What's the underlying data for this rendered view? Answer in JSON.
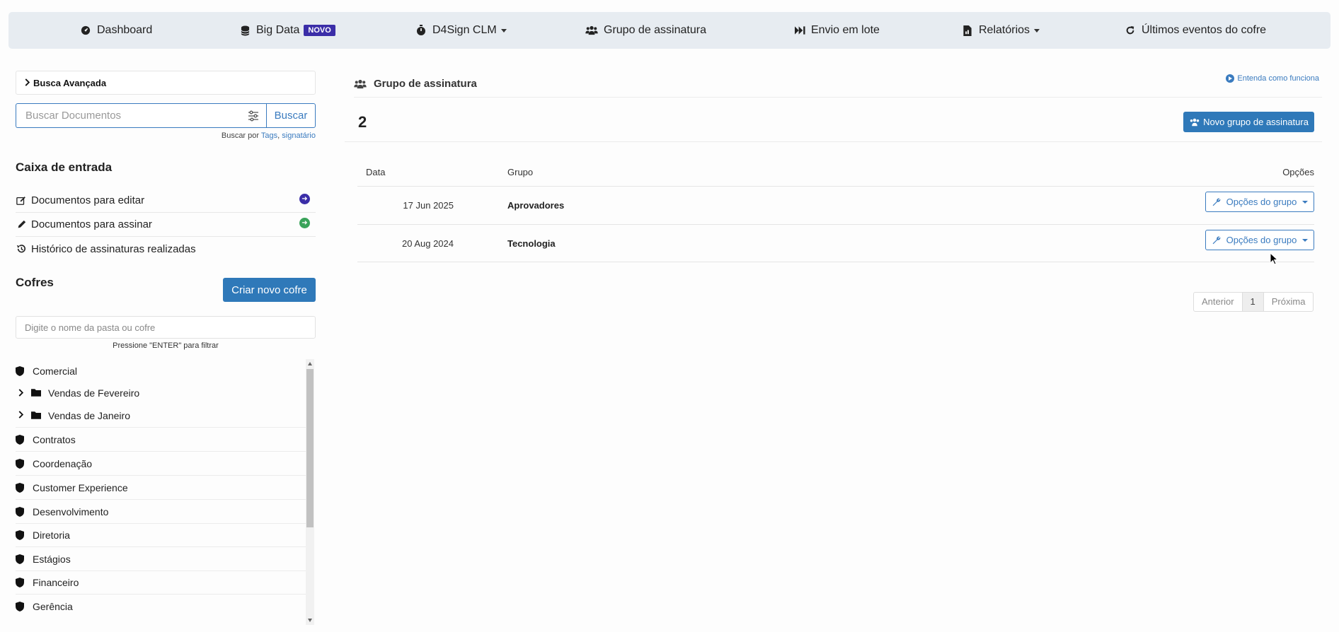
{
  "navbar": {
    "items": [
      {
        "label": "Dashboard",
        "icon": "dashboard-icon"
      },
      {
        "label": "Big Data",
        "icon": "database-icon",
        "badge": "NOVO"
      },
      {
        "label": "D4Sign CLM",
        "icon": "stopwatch-icon",
        "dropdown": true
      },
      {
        "label": "Grupo de assinatura",
        "icon": "users-icon"
      },
      {
        "label": "Envio em lote",
        "icon": "fast-forward-icon"
      },
      {
        "label": "Relatórios",
        "icon": "file-report-icon",
        "dropdown": true
      },
      {
        "label": "Últimos eventos do cofre",
        "icon": "refresh-icon"
      }
    ]
  },
  "sidebar": {
    "busca_avancada": "Busca Avançada",
    "search_placeholder": "Buscar Documentos",
    "search_button": "Buscar",
    "search_hint_prefix": "Buscar por ",
    "search_hint_tags": "Tags",
    "search_hint_sep": ", ",
    "search_hint_signatario": "signatário",
    "inbox_title": "Caixa de entrada",
    "inbox_items": [
      {
        "label": "Documentos para editar"
      },
      {
        "label": "Documentos para assinar"
      },
      {
        "label": "Histórico de assinaturas realizadas"
      }
    ],
    "cofres_title": "Cofres",
    "criar_cofre": "Criar novo cofre",
    "pasta_placeholder": "Digite o nome da pasta ou cofre",
    "pasta_hint": "Pressione \"ENTER\" para filtrar",
    "cofres": [
      {
        "label": "Comercial"
      },
      {
        "label": "Vendas de Fevereiro"
      },
      {
        "label": "Vendas de Janeiro"
      },
      {
        "label": "Contratos"
      },
      {
        "label": "Coordenação"
      },
      {
        "label": "Customer Experience"
      },
      {
        "label": "Desenvolvimento"
      },
      {
        "label": "Diretoria"
      },
      {
        "label": "Estágios"
      },
      {
        "label": "Financeiro"
      },
      {
        "label": "Gerência"
      }
    ]
  },
  "main": {
    "title": "Grupo de assinatura",
    "help_link": "Entenda como funciona",
    "count": "2",
    "new_button": "Novo grupo de assinatura",
    "table": {
      "headers": {
        "date": "Data",
        "group": "Grupo",
        "options": "Opções"
      },
      "rows": [
        {
          "date": "17 Jun 2025",
          "group": "Aprovadores",
          "options": "Opções do grupo"
        },
        {
          "date": "20 Aug 2024",
          "group": "Tecnologia",
          "options": "Opções do grupo"
        }
      ]
    },
    "pagination": {
      "prev": "Anterior",
      "current": "1",
      "next": "Próxima"
    }
  },
  "colors": {
    "primary": "#2f79b9",
    "badge": "#3b2ea8",
    "navbar_bg": "#e7ecf1",
    "edit_dot": "#3b2ea8",
    "sign_dot": "#3aa35a"
  }
}
